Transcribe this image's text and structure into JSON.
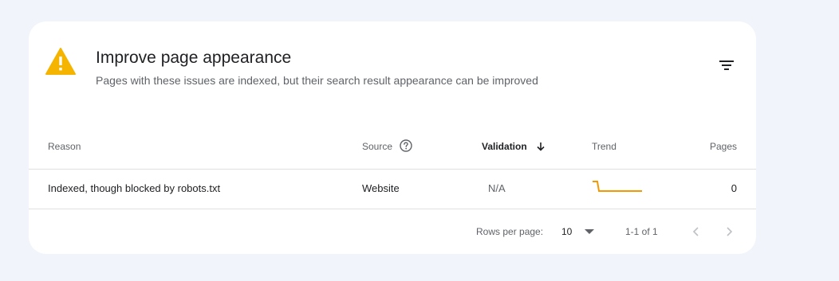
{
  "panel": {
    "title": "Improve page appearance",
    "subtitle": "Pages with these issues are indexed, but their search result appearance can be improved",
    "warning_color": "#f4b400",
    "filter_icon": "filter-list-icon"
  },
  "table": {
    "headers": {
      "reason": "Reason",
      "source": "Source",
      "validation": "Validation",
      "trend": "Trend",
      "pages": "Pages"
    },
    "sorted_column": "validation",
    "sort_direction": "descending",
    "rows": [
      {
        "reason": "Indexed, though blocked by robots.txt",
        "source": "Website",
        "validation": "N/A",
        "trend_color": "#f29900",
        "pages": "0"
      }
    ]
  },
  "pagination": {
    "rows_per_page_label": "Rows per page:",
    "rows_per_page_value": "10",
    "range_text": "1-1 of 1"
  }
}
